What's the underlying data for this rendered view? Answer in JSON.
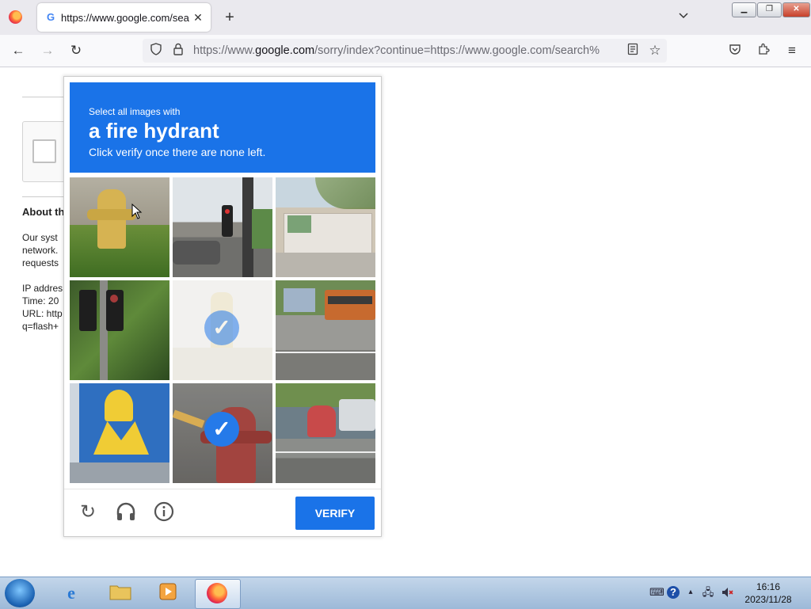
{
  "browser": {
    "tab_title": "https://www.google.com/sea",
    "tab_icon": "G",
    "url_host_prefix": "https://www.",
    "url_host": "google.com",
    "url_rest": "/sorry/index?continue=https://www.google.com/search%"
  },
  "page": {
    "about_heading": "About th",
    "about_lines": [
      "Our syst",
      "network.",
      "requests"
    ],
    "info_lines": [
      "IP addres",
      "Time: 20",
      "URL: http",
      "q=flash+"
    ]
  },
  "captcha": {
    "instruction_small": "Select all images with",
    "instruction_target": "a fire hydrant",
    "instruction_sub": "Click verify once there are none left.",
    "tiles": [
      {
        "content": "yellow fire hydrant in grass",
        "selected": false
      },
      {
        "content": "traffic light and street",
        "selected": false
      },
      {
        "content": "palm tree and building",
        "selected": false
      },
      {
        "content": "traffic light among trees",
        "selected": false
      },
      {
        "content": "faded hydrant",
        "selected": true
      },
      {
        "content": "bus on street",
        "selected": false
      },
      {
        "content": "billboard",
        "selected": false
      },
      {
        "content": "red fire hydrant",
        "selected": true
      },
      {
        "content": "motorcycles on road",
        "selected": false
      }
    ],
    "verify_label": "VERIFY",
    "icons": [
      "reload-icon",
      "headphones-icon",
      "info-icon"
    ]
  },
  "taskbar": {
    "time": "16:16",
    "date": "2023/11/28"
  },
  "colors": {
    "captcha_blue": "#1a73e8"
  }
}
